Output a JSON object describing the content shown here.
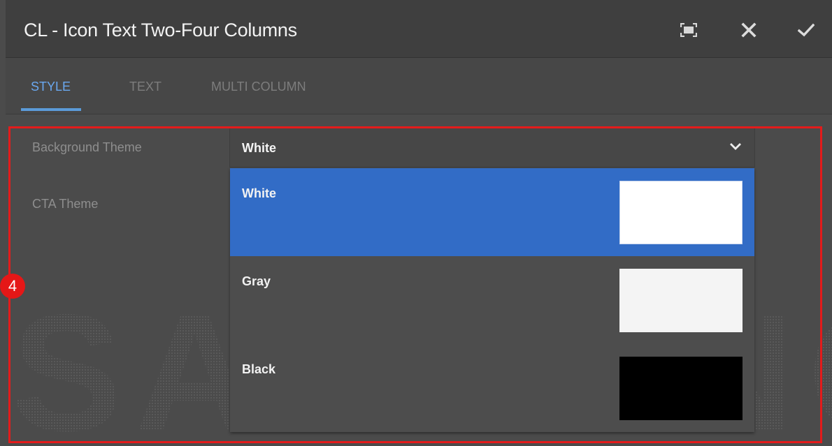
{
  "dialog": {
    "title": "CL - Icon Text Two-Four Columns",
    "icons": {
      "fullscreen": "fullscreen-icon",
      "close": "close-icon",
      "confirm": "checkmark-icon"
    }
  },
  "tabs": [
    {
      "label": "STYLE",
      "active": true
    },
    {
      "label": "TEXT",
      "active": false
    },
    {
      "label": "MULTI COLUMN",
      "active": false
    }
  ],
  "fields": {
    "background_theme": {
      "label": "Background Theme",
      "value": "White",
      "options": [
        {
          "label": "White",
          "swatch": "#ffffff",
          "selected": true
        },
        {
          "label": "Gray",
          "swatch": "#f4f4f4",
          "selected": false
        },
        {
          "label": "Black",
          "swatch": "#000000",
          "selected": false
        }
      ]
    },
    "cta_theme": {
      "label": "CTA Theme"
    }
  },
  "annotation": {
    "badge": "4",
    "color": "#e41b1b"
  },
  "watermark": "SAMSUNG",
  "colors": {
    "accent": "#5b9bd9",
    "selected_option": "#326cc6"
  }
}
